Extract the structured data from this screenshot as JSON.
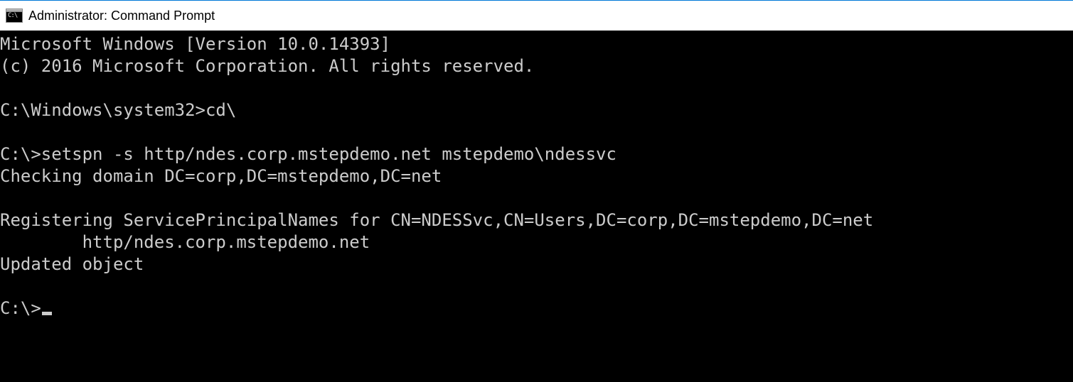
{
  "window": {
    "title": "Administrator: Command Prompt",
    "icon_label": "C:\\"
  },
  "terminal": {
    "lines": [
      "Microsoft Windows [Version 10.0.14393]",
      "(c) 2016 Microsoft Corporation. All rights reserved.",
      "",
      "C:\\Windows\\system32>cd\\",
      "",
      "C:\\>setspn -s http/ndes.corp.mstepdemo.net mstepdemo\\ndessvc",
      "Checking domain DC=corp,DC=mstepdemo,DC=net",
      "",
      "Registering ServicePrincipalNames for CN=NDESSvc,CN=Users,DC=corp,DC=mstepdemo,DC=net",
      "        http/ndes.corp.mstepdemo.net",
      "Updated object",
      "",
      "C:\\>"
    ],
    "cursor_on_last": true
  }
}
